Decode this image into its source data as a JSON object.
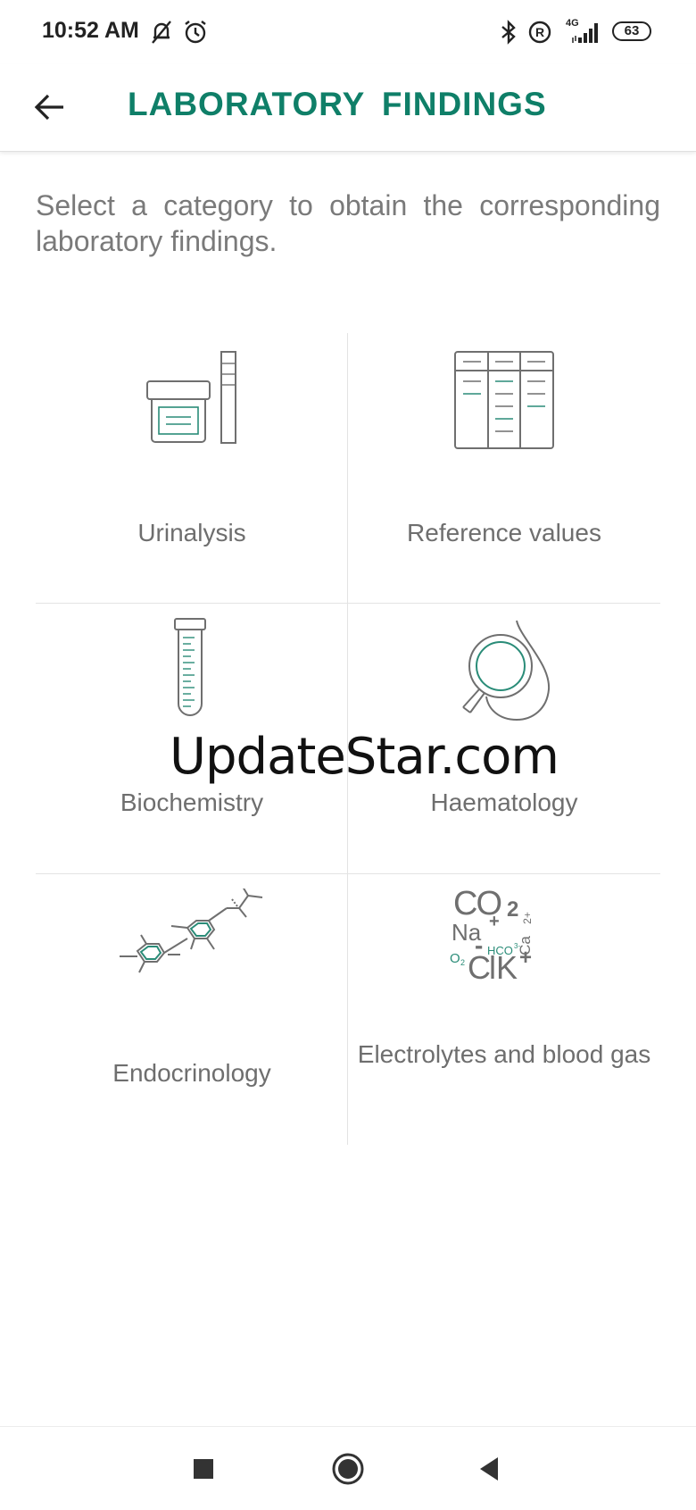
{
  "status_bar": {
    "time": "10:52 AM",
    "network_label": "4G",
    "battery": "63",
    "icons": [
      "muted-bell-icon",
      "alarm-icon",
      "bluetooth-icon",
      "registered-icon",
      "signal-icon",
      "battery-icon"
    ]
  },
  "app_bar": {
    "title": "LABORATORY FINDINGS",
    "back_icon": "arrow-left-icon"
  },
  "intro": {
    "text": "Select a category to obtain the corresponding laboratory findings."
  },
  "categories": [
    {
      "label": "Urinalysis",
      "icon": "urine-sample-icon"
    },
    {
      "label": "Reference values",
      "icon": "reference-table-icon"
    },
    {
      "label": "Biochemistry",
      "icon": "test-tube-icon"
    },
    {
      "label": "Haematology",
      "icon": "blood-drop-magnifier-icon"
    },
    {
      "label": "Endocrinology",
      "icon": "molecule-icon"
    },
    {
      "label": "Electrolytes and blood gas",
      "icon": "electrolytes-icon"
    }
  ],
  "electrolytes_icon_text": {
    "co": "CO",
    "two": "2",
    "na": "Na",
    "plus": "+",
    "ca": "Ca",
    "ca_charge": "2+",
    "hco": "HCO",
    "hco_charge": "3-",
    "o": "O",
    "o_sub": "2",
    "cl": "Cl",
    "minus": "-",
    "k": "K",
    "k_plus": "+"
  },
  "watermark": "UpdateStar.com",
  "nav_bar": {
    "icons": [
      "recents-square-icon",
      "home-circle-icon",
      "back-triangle-icon"
    ]
  },
  "colors": {
    "accent": "#0f7f68",
    "icon_gray": "#6f6f6f",
    "icon_green": "#2a8c78",
    "divider": "#e3e3e3"
  }
}
